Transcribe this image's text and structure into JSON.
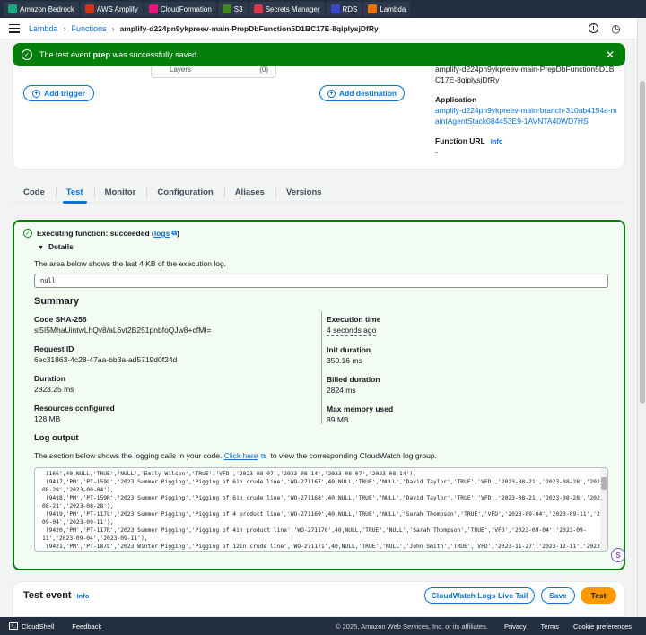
{
  "bookmarks": [
    {
      "label": "Amazon Bedrock",
      "color": "#1aa77c"
    },
    {
      "label": "AWS Amplify",
      "color": "#d13212"
    },
    {
      "label": "CloudFormation",
      "color": "#e7157b"
    },
    {
      "label": "S3",
      "color": "#3f8624"
    },
    {
      "label": "Secrets Manager",
      "color": "#dd344c"
    },
    {
      "label": "RDS",
      "color": "#3b48cc"
    },
    {
      "label": "Lambda",
      "color": "#ed7100"
    }
  ],
  "breadcrumb": {
    "lambda": "Lambda",
    "functions": "Functions",
    "current": "amplify-d224pn9ykpreev-main-PrepDbFunction5D1BC17E-8qiplysjDfRy",
    "sep": "›"
  },
  "topbar": {
    "info_icon": "i",
    "clock_icon": "◷"
  },
  "flash": {
    "prefix": "The test event ",
    "event_name": "prep",
    "suffix": " was successfully saved.",
    "check": "✓",
    "close": "✕"
  },
  "overview": {
    "layers_label": "Layers",
    "layers_count": "(0)",
    "add_trigger": "Add trigger",
    "add_destination": "Add destination",
    "plus": "+",
    "function_name_value": "amplify-d224pn9ykpreev-main-PrepDbFunction5D1BC17E-8qiplysjDfRy",
    "application_label": "Application",
    "application_value": "amplify-d224pn9ykpreev-main-branch-310ab4154a-maintAgentStack084453E9-1AVNTA40WD7HS",
    "function_url_label": "Function URL",
    "function_url_info": "Info",
    "function_url_value": "-"
  },
  "tabs": [
    {
      "label": "Code",
      "active": false
    },
    {
      "label": "Test",
      "active": true
    },
    {
      "label": "Monitor",
      "active": false
    },
    {
      "label": "Configuration",
      "active": false
    },
    {
      "label": "Aliases",
      "active": false
    },
    {
      "label": "Versions",
      "active": false
    }
  ],
  "result": {
    "status_prefix": "Executing function: succeeded (",
    "logs_link": "logs",
    "status_suffix": ")",
    "check": "✓",
    "details": "Details",
    "area_text": "The area below shows the last 4 KB of the execution log.",
    "output_value": "null",
    "summary_title": "Summary",
    "left": [
      {
        "key": "Code SHA-256",
        "value": "sl5I5MhaUintwLhQv8/aL6vf2B251pnbfoQJw8+cfMI="
      },
      {
        "key": "Request ID",
        "value": "6ec31863-4c28-47aa-bb3a-ad5719d0f24d"
      },
      {
        "key": "Duration",
        "value": "2823.25 ms"
      },
      {
        "key": "Resources configured",
        "value": "128 MB"
      }
    ],
    "right": [
      {
        "key": "Execution time",
        "value": "4 seconds ago"
      },
      {
        "key": "Init duration",
        "value": "350.16 ms"
      },
      {
        "key": "Billed duration",
        "value": "2824 ms"
      },
      {
        "key": "Max memory used",
        "value": "89 MB"
      }
    ],
    "log_title": "Log output",
    "log_desc_prefix": "The section below shows the logging calls in your code. ",
    "log_desc_link": "Click here",
    "log_desc_suffix": " to view the corresponding CloudWatch log group.",
    "log_lines": [
      " 1166',40,NULL,'TRUE','NULL','Emily Wilson','TRUE','VFD','2023-08-07','2023-08-14','2023-08-07','2023-08-14'),",
      " (9417,'PM','PT-159L','2023 Summer Pigging','Pigging of 6in crude line','WO-271167',40,NULL,'TRUE','NULL','David Taylor','TRUE','VFD','2023-08-21','2023-08-28','2023-",
      "08-28','2023-09-04'),",
      " (9418,'PM','PT-159R','2023 Summer Pigging','Pigging of 6in crude line','WO-271168',40,NULL,'TRUE','NULL','David Taylor','TRUE','VFD','2023-08-21','2023-08-28','2023-",
      "08-21','2023-08-28'),",
      " (9419,'PM','PT-117L','2023 Summer Pigging','Pigging of 4 product line','WO-271169',40,NULL,'TRUE','NULL','Sarah Thompson','TRUE','VFD','2023-09-04','2023-09-11','2023-",
      "09-04','2023-09-11'),",
      " (9420,'PM','PT-117R','2023 Summer Pigging','Pigging of 4in product line','WO-271170',40,NULL,'TRUE','NULL','Sarah Thompson','TRUE','VFD','2023-09-04','2023-09-",
      "11','2023-09-04','2023-09-11'),",
      " (9421,'PM','PT-187L','2023 Winter Pigging','Pigging of 12in crude line','WO-271171',40,NULL,'TRUE','NULL','John Smith','TRUE','VFD','2023-11-27','2023-12-11','2023-11-"
    ]
  },
  "test_event": {
    "title": "Test event",
    "info": "Info",
    "live_tail": "CloudWatch Logs Live Tail",
    "save": "Save",
    "test": "Test"
  },
  "footer": {
    "cloudshell": "CloudShell",
    "feedback": "Feedback",
    "copyright": "© 2025, Amazon Web Services, Inc. or its affiliates.",
    "privacy": "Privacy",
    "terms": "Terms",
    "cookies": "Cookie preferences"
  }
}
